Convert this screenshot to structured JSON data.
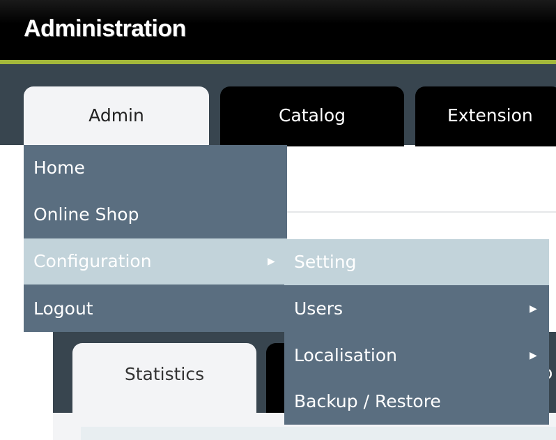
{
  "header": {
    "title": "Administration"
  },
  "top_tabs": [
    {
      "label": "Admin",
      "active": true
    },
    {
      "label": "Catalog",
      "active": false
    },
    {
      "label": "Extension",
      "active": false
    }
  ],
  "admin_menu": {
    "items": [
      {
        "label": "Home"
      },
      {
        "label": "Online Shop"
      },
      {
        "label": "Configuration",
        "highlighted": true,
        "has_submenu": true
      },
      {
        "label": "Logout"
      }
    ]
  },
  "configuration_submenu": {
    "items": [
      {
        "label": "Setting",
        "highlighted": true
      },
      {
        "label": "Users",
        "has_submenu": true
      },
      {
        "label": "Localisation",
        "has_submenu": true
      },
      {
        "label": "Backup / Restore"
      }
    ]
  },
  "sub_tabs": [
    {
      "label": "Statistics",
      "active": true
    },
    {
      "label": "o"
    }
  ],
  "icons": {
    "submenu_arrow": "triangle-right-icon"
  },
  "colors": {
    "header_bg": "#000000",
    "accent": "#a4b83a",
    "tabbar_bg": "#38454f",
    "menu_bg": "#5a6e80",
    "menu_highlight": "#c2d3da"
  }
}
